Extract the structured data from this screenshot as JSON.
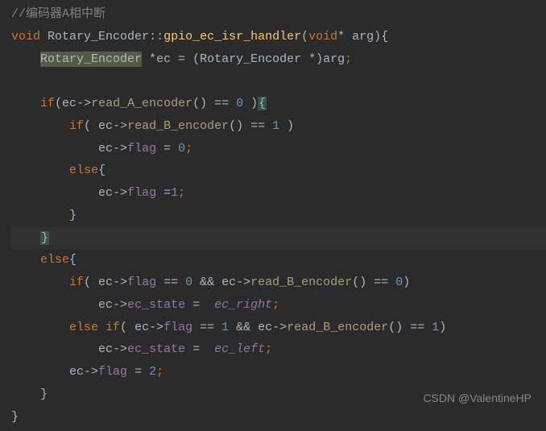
{
  "code": {
    "line1_comment": "//编码器A相中断",
    "line2": {
      "void": "void",
      "class": "Rotary_Encoder",
      "scope": "::",
      "method": "gpio_ec_isr_handler",
      "lparen": "(",
      "void2": "void",
      "ptr": "* ",
      "arg": "arg",
      "rparen": ")",
      "lbrace": "{"
    },
    "line3": {
      "class": "Rotary_Encoder",
      "ptr": " *",
      "var": "ec",
      "eq": " = (",
      "class2": "Rotary_Encoder",
      "ptr2": " *)",
      "arg": "arg",
      "semi": ";"
    },
    "line5": {
      "if": "if",
      "lparen": "(",
      "ec": "ec",
      "arrow": "->",
      "method": "read_A_encoder",
      "parens": "()",
      "eq": " == ",
      "zero": "0",
      "space": " )",
      "lbrace": "{"
    },
    "line6": {
      "if": "if",
      "lparen": "( ",
      "ec": "ec",
      "arrow": "->",
      "method": "read_B_encoder",
      "parens": "()",
      "eq": " == ",
      "one": "1",
      "rparen": " )"
    },
    "line7": {
      "ec": "ec",
      "arrow": "->",
      "field": "flag",
      "eq": " = ",
      "zero": "0",
      "semi": ";"
    },
    "line8": {
      "else": "else",
      "lbrace": "{"
    },
    "line9": {
      "ec": "ec",
      "arrow": "->",
      "field": "flag",
      "eq": " =",
      "one": "1",
      "semi": ";"
    },
    "line10": {
      "rbrace": "}"
    },
    "line11": {
      "rbrace": "}"
    },
    "line12": {
      "else": "else",
      "lbrace": "{"
    },
    "line13": {
      "if": "if",
      "lparen": "( ",
      "ec": "ec",
      "arrow": "->",
      "field": "flag",
      "eq": " == ",
      "zero": "0",
      "and": " && ",
      "ec2": "ec",
      "arrow2": "->",
      "method": "read_B_encoder",
      "parens": "()",
      "eq2": " == ",
      "zero2": "0",
      "rparen": ")"
    },
    "line14": {
      "ec": "ec",
      "arrow": "->",
      "field": "ec_state",
      "eq": " =  ",
      "const": "ec_right",
      "semi": ";"
    },
    "line15": {
      "else": "else",
      "if": " if",
      "lparen": "( ",
      "ec": "ec",
      "arrow": "->",
      "field": "flag",
      "eq": " == ",
      "one": "1",
      "and": " && ",
      "ec2": "ec",
      "arrow2": "->",
      "method": "read_B_encoder",
      "parens": "()",
      "eq2": " == ",
      "one2": "1",
      "rparen": ")"
    },
    "line16": {
      "ec": "ec",
      "arrow": "->",
      "field": "ec_state",
      "eq": " =  ",
      "const": "ec_left",
      "semi": ";"
    },
    "line17": {
      "ec": "ec",
      "arrow": "->",
      "field": "flag",
      "eq": " = ",
      "two": "2",
      "semi": ";"
    },
    "line18": {
      "rbrace": "}"
    },
    "line19": {
      "rbrace": "}"
    }
  },
  "watermark": "CSDN @ValentineHP"
}
